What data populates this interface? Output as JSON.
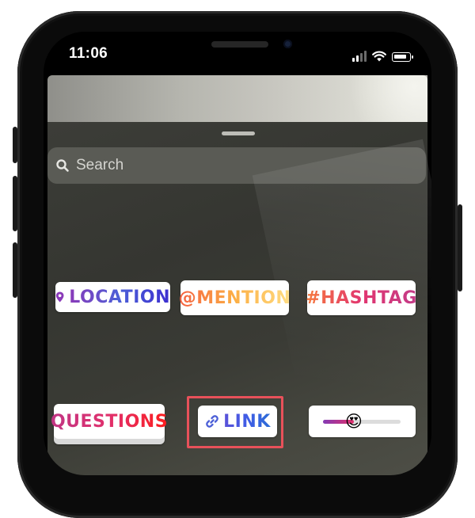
{
  "status_bar": {
    "time": "11:06",
    "icons": [
      "cellular-signal-icon",
      "wifi-icon",
      "battery-icon"
    ]
  },
  "search": {
    "placeholder": "Search",
    "icon": "search-icon"
  },
  "stickers": {
    "location": {
      "label": "LOCATION",
      "icon": "location-pin-icon"
    },
    "mention": {
      "label": "@MENTION"
    },
    "hashtag": {
      "label": "#HASHTAG"
    },
    "questions": {
      "label": "QUESTIONS"
    },
    "link": {
      "label": "LINK",
      "icon": "link-chain-icon",
      "highlighted": true
    },
    "emoji_slider": {
      "emoji": "😍",
      "level": 0.4
    }
  },
  "colors": {
    "sheet": "#3a3b35",
    "search_bg": "#5a5b55",
    "highlight": "#e8515a",
    "gradient_purple": "#833ab4",
    "gradient_pink": "#e1306c",
    "gradient_orange": "#fcaf45"
  }
}
